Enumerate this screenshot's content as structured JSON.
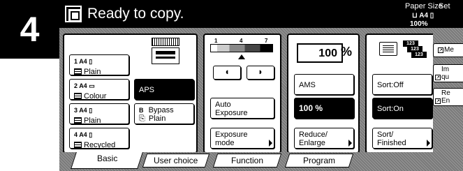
{
  "screen_number": "4",
  "status": {
    "text": "Ready to copy."
  },
  "header": {
    "paper_size_label": "Paper Size",
    "set_label": "Set",
    "paper_size_value": "A4",
    "zoom_value": "100%"
  },
  "paper": {
    "drawers": [
      {
        "tray": "1",
        "size": "A4",
        "type": "Plain"
      },
      {
        "tray": "2",
        "size": "A4",
        "type": "Colour"
      },
      {
        "tray": "3",
        "size": "A4",
        "type": "Plain"
      },
      {
        "tray": "4",
        "size": "A4",
        "type": "Recycled"
      }
    ],
    "aps_label": "APS",
    "bypass": {
      "tray": "B",
      "label": "Bypass",
      "type": "Plain"
    }
  },
  "exposure": {
    "scale_labels": [
      "1",
      "4",
      "7"
    ],
    "auto_label": "Auto\nExposure",
    "mode_label": "Exposure\nmode"
  },
  "reduce": {
    "zoom_value": "100",
    "percent_symbol": "%",
    "ams_label": "AMS",
    "zoom_button_label": "100 %",
    "reduce_label": "Reduce/\nEnlarge"
  },
  "sort": {
    "stack_labels": [
      "123",
      "123",
      "123"
    ],
    "off_label": "Sort:Off",
    "on_label": "Sort:On",
    "finished_label": "Sort/\nFinished"
  },
  "tabs": [
    {
      "label": "Basic"
    },
    {
      "label": "User choice"
    },
    {
      "label": "Function"
    },
    {
      "label": "Program"
    }
  ],
  "right_bar": {
    "memory": "Me",
    "image_quality": "Im\nqu",
    "reserve": "Re\nEn"
  },
  "colors": {
    "screen_bg": "#7a7a7a",
    "header_bg": "#000000",
    "selected_bg": "#000000"
  }
}
